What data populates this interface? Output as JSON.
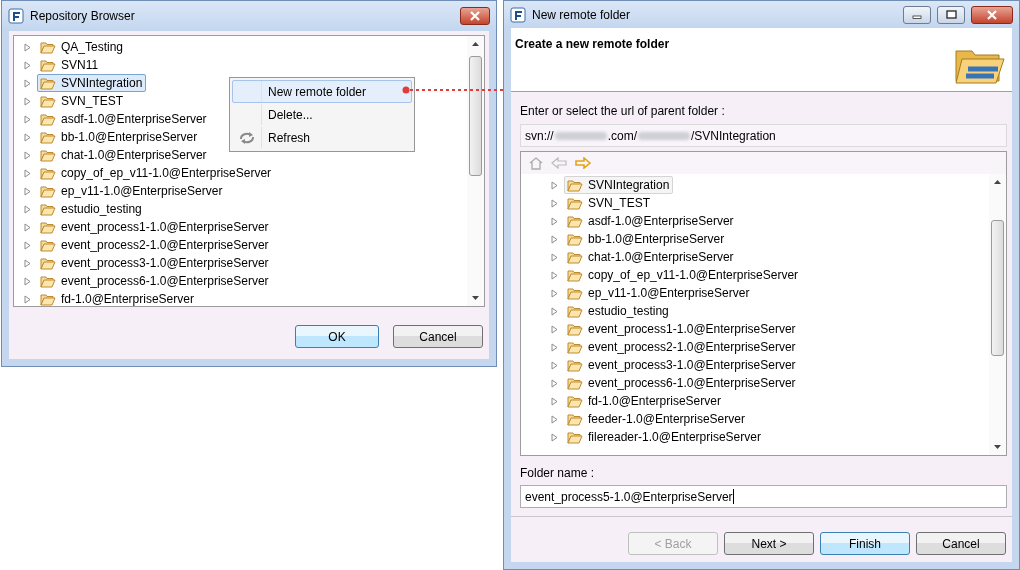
{
  "repository_browser": {
    "window": {
      "title": "Repository Browser"
    },
    "tree": [
      {
        "label": "QA_Testing",
        "selected": false
      },
      {
        "label": "SVN11",
        "selected": false
      },
      {
        "label": "SVNIntegration",
        "selected": true
      },
      {
        "label": "SVN_TEST",
        "selected": false
      },
      {
        "label": "asdf-1.0@EnterpriseServer",
        "selected": false
      },
      {
        "label": "bb-1.0@EnterpriseServer",
        "selected": false
      },
      {
        "label": "chat-1.0@EnterpriseServer",
        "selected": false
      },
      {
        "label": "copy_of_ep_v11-1.0@EnterpriseServer",
        "selected": false
      },
      {
        "label": "ep_v11-1.0@EnterpriseServer",
        "selected": false
      },
      {
        "label": "estudio_testing",
        "selected": false
      },
      {
        "label": "event_process1-1.0@EnterpriseServer",
        "selected": false
      },
      {
        "label": "event_process2-1.0@EnterpriseServer",
        "selected": false
      },
      {
        "label": "event_process3-1.0@EnterpriseServer",
        "selected": false
      },
      {
        "label": "event_process6-1.0@EnterpriseServer",
        "selected": false
      },
      {
        "label": "fd-1.0@EnterpriseServer",
        "selected": false
      }
    ],
    "context_menu": [
      {
        "label": "New remote folder",
        "kind": "plain",
        "selected": true
      },
      {
        "label": "Delete...",
        "kind": "plain",
        "selected": false
      },
      {
        "label": "Refresh",
        "kind": "refresh",
        "selected": false
      }
    ],
    "buttons": [
      {
        "label": "OK",
        "default": true,
        "disabled": false
      },
      {
        "label": "Cancel",
        "default": false,
        "disabled": false
      }
    ]
  },
  "new_remote_folder": {
    "window": {
      "title": "New remote folder"
    },
    "heading": "Create a new remote folder",
    "url_label": "Enter or select the url of parent folder :",
    "url_parts": [
      {
        "text": "svn://",
        "kind": "text"
      },
      {
        "kind": "blurred"
      },
      {
        "text": ".com/",
        "kind": "text"
      },
      {
        "kind": "blurred"
      },
      {
        "text": "/SVNIntegration",
        "kind": "text"
      }
    ],
    "tree": [
      {
        "label": "SVNIntegration",
        "selected": true
      },
      {
        "label": "SVN_TEST",
        "selected": false
      },
      {
        "label": "asdf-1.0@EnterpriseServer",
        "selected": false
      },
      {
        "label": "bb-1.0@EnterpriseServer",
        "selected": false
      },
      {
        "label": "chat-1.0@EnterpriseServer",
        "selected": false
      },
      {
        "label": "copy_of_ep_v11-1.0@EnterpriseServer",
        "selected": false
      },
      {
        "label": "ep_v11-1.0@EnterpriseServer",
        "selected": false
      },
      {
        "label": "estudio_testing",
        "selected": false
      },
      {
        "label": "event_process1-1.0@EnterpriseServer",
        "selected": false
      },
      {
        "label": "event_process2-1.0@EnterpriseServer",
        "selected": false
      },
      {
        "label": "event_process3-1.0@EnterpriseServer",
        "selected": false
      },
      {
        "label": "event_process6-1.0@EnterpriseServer",
        "selected": false
      },
      {
        "label": "fd-1.0@EnterpriseServer",
        "selected": false
      },
      {
        "label": "feeder-1.0@EnterpriseServer",
        "selected": false
      },
      {
        "label": "filereader-1.0@EnterpriseServer",
        "selected": false
      }
    ],
    "folder_name_label": "Folder name :",
    "folder_name_value": "event_process5-1.0@EnterpriseServer",
    "buttons": [
      {
        "label": "< Back",
        "default": false,
        "disabled": true
      },
      {
        "label": "Next >",
        "default": false,
        "disabled": false
      },
      {
        "label": "Finish",
        "default": true,
        "disabled": false
      },
      {
        "label": "Cancel",
        "default": false,
        "disabled": false
      }
    ]
  }
}
